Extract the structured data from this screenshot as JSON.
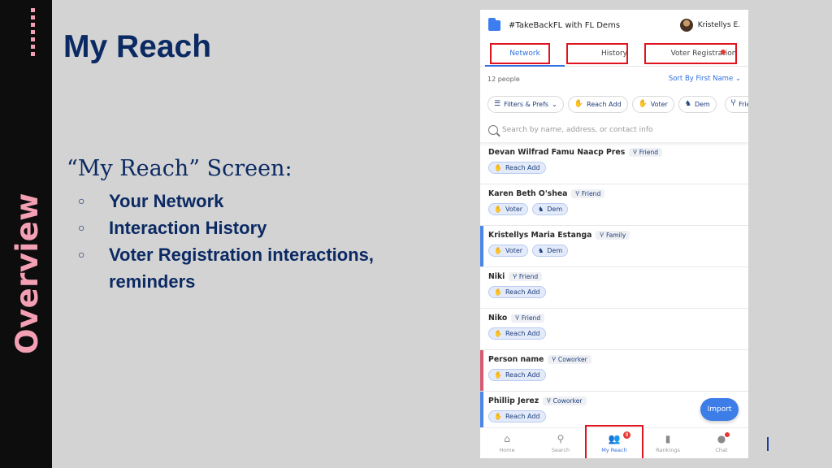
{
  "slide": {
    "side_label": "Overview",
    "title": "My Reach",
    "screen_heading": "“My Reach” Screen:",
    "bullets": [
      "Your Network",
      "Interaction History",
      "Voter Registration interactions, reminders"
    ]
  },
  "app": {
    "name": "#TakeBackFL with FL Dems",
    "user_name": "Kristellys E."
  },
  "tabs": [
    {
      "label": "Network",
      "active": true
    },
    {
      "label": "History",
      "active": false
    },
    {
      "label": "Voter Registration",
      "active": false
    }
  ],
  "list_header": {
    "count": "12 people",
    "sort_label": "Sort By First Name"
  },
  "filters": [
    "Filters & Prefs",
    "Reach Add",
    "Voter",
    "Dem",
    "Friend"
  ],
  "search": {
    "placeholder": "Search by name, address, or contact info"
  },
  "people": [
    {
      "name": "Devan Wilfrad Famu Naacp Pres",
      "relation": "Friend",
      "tags": [
        "Reach Add"
      ],
      "accent": ""
    },
    {
      "name": "Karen Beth O'shea",
      "relation": "Friend",
      "tags": [
        "Voter",
        "Dem"
      ],
      "accent": ""
    },
    {
      "name": "Kristellys Maria Estanga",
      "relation": "Family",
      "tags": [
        "Voter",
        "Dem"
      ],
      "accent": "#4a86e8"
    },
    {
      "name": "Niki",
      "relation": "Friend",
      "tags": [
        "Reach Add"
      ],
      "accent": ""
    },
    {
      "name": "Niko",
      "relation": "Friend",
      "tags": [
        "Reach Add"
      ],
      "accent": ""
    },
    {
      "name": "Person name",
      "relation": "Coworker",
      "tags": [
        "Reach Add"
      ],
      "accent": "#d65a72"
    },
    {
      "name": "Phillip Jerez",
      "relation": "Coworker",
      "tags": [
        "Reach Add"
      ],
      "accent": "#4a86e8"
    }
  ],
  "import_label": "Import",
  "bottom_nav": [
    {
      "label": "Home",
      "icon": "home-icon",
      "active": false
    },
    {
      "label": "Search",
      "icon": "search-icon",
      "active": false
    },
    {
      "label": "My Reach",
      "icon": "people-icon",
      "active": true,
      "badge": "8"
    },
    {
      "label": "Rankings",
      "icon": "bar-chart-icon",
      "active": false
    },
    {
      "label": "Chat",
      "icon": "chat-icon",
      "active": false
    }
  ],
  "colors": {
    "navy": "#0b2a63",
    "pink": "#f4a0b4",
    "app_blue": "#2f6fe0",
    "highlight_red": "#e0141e"
  }
}
